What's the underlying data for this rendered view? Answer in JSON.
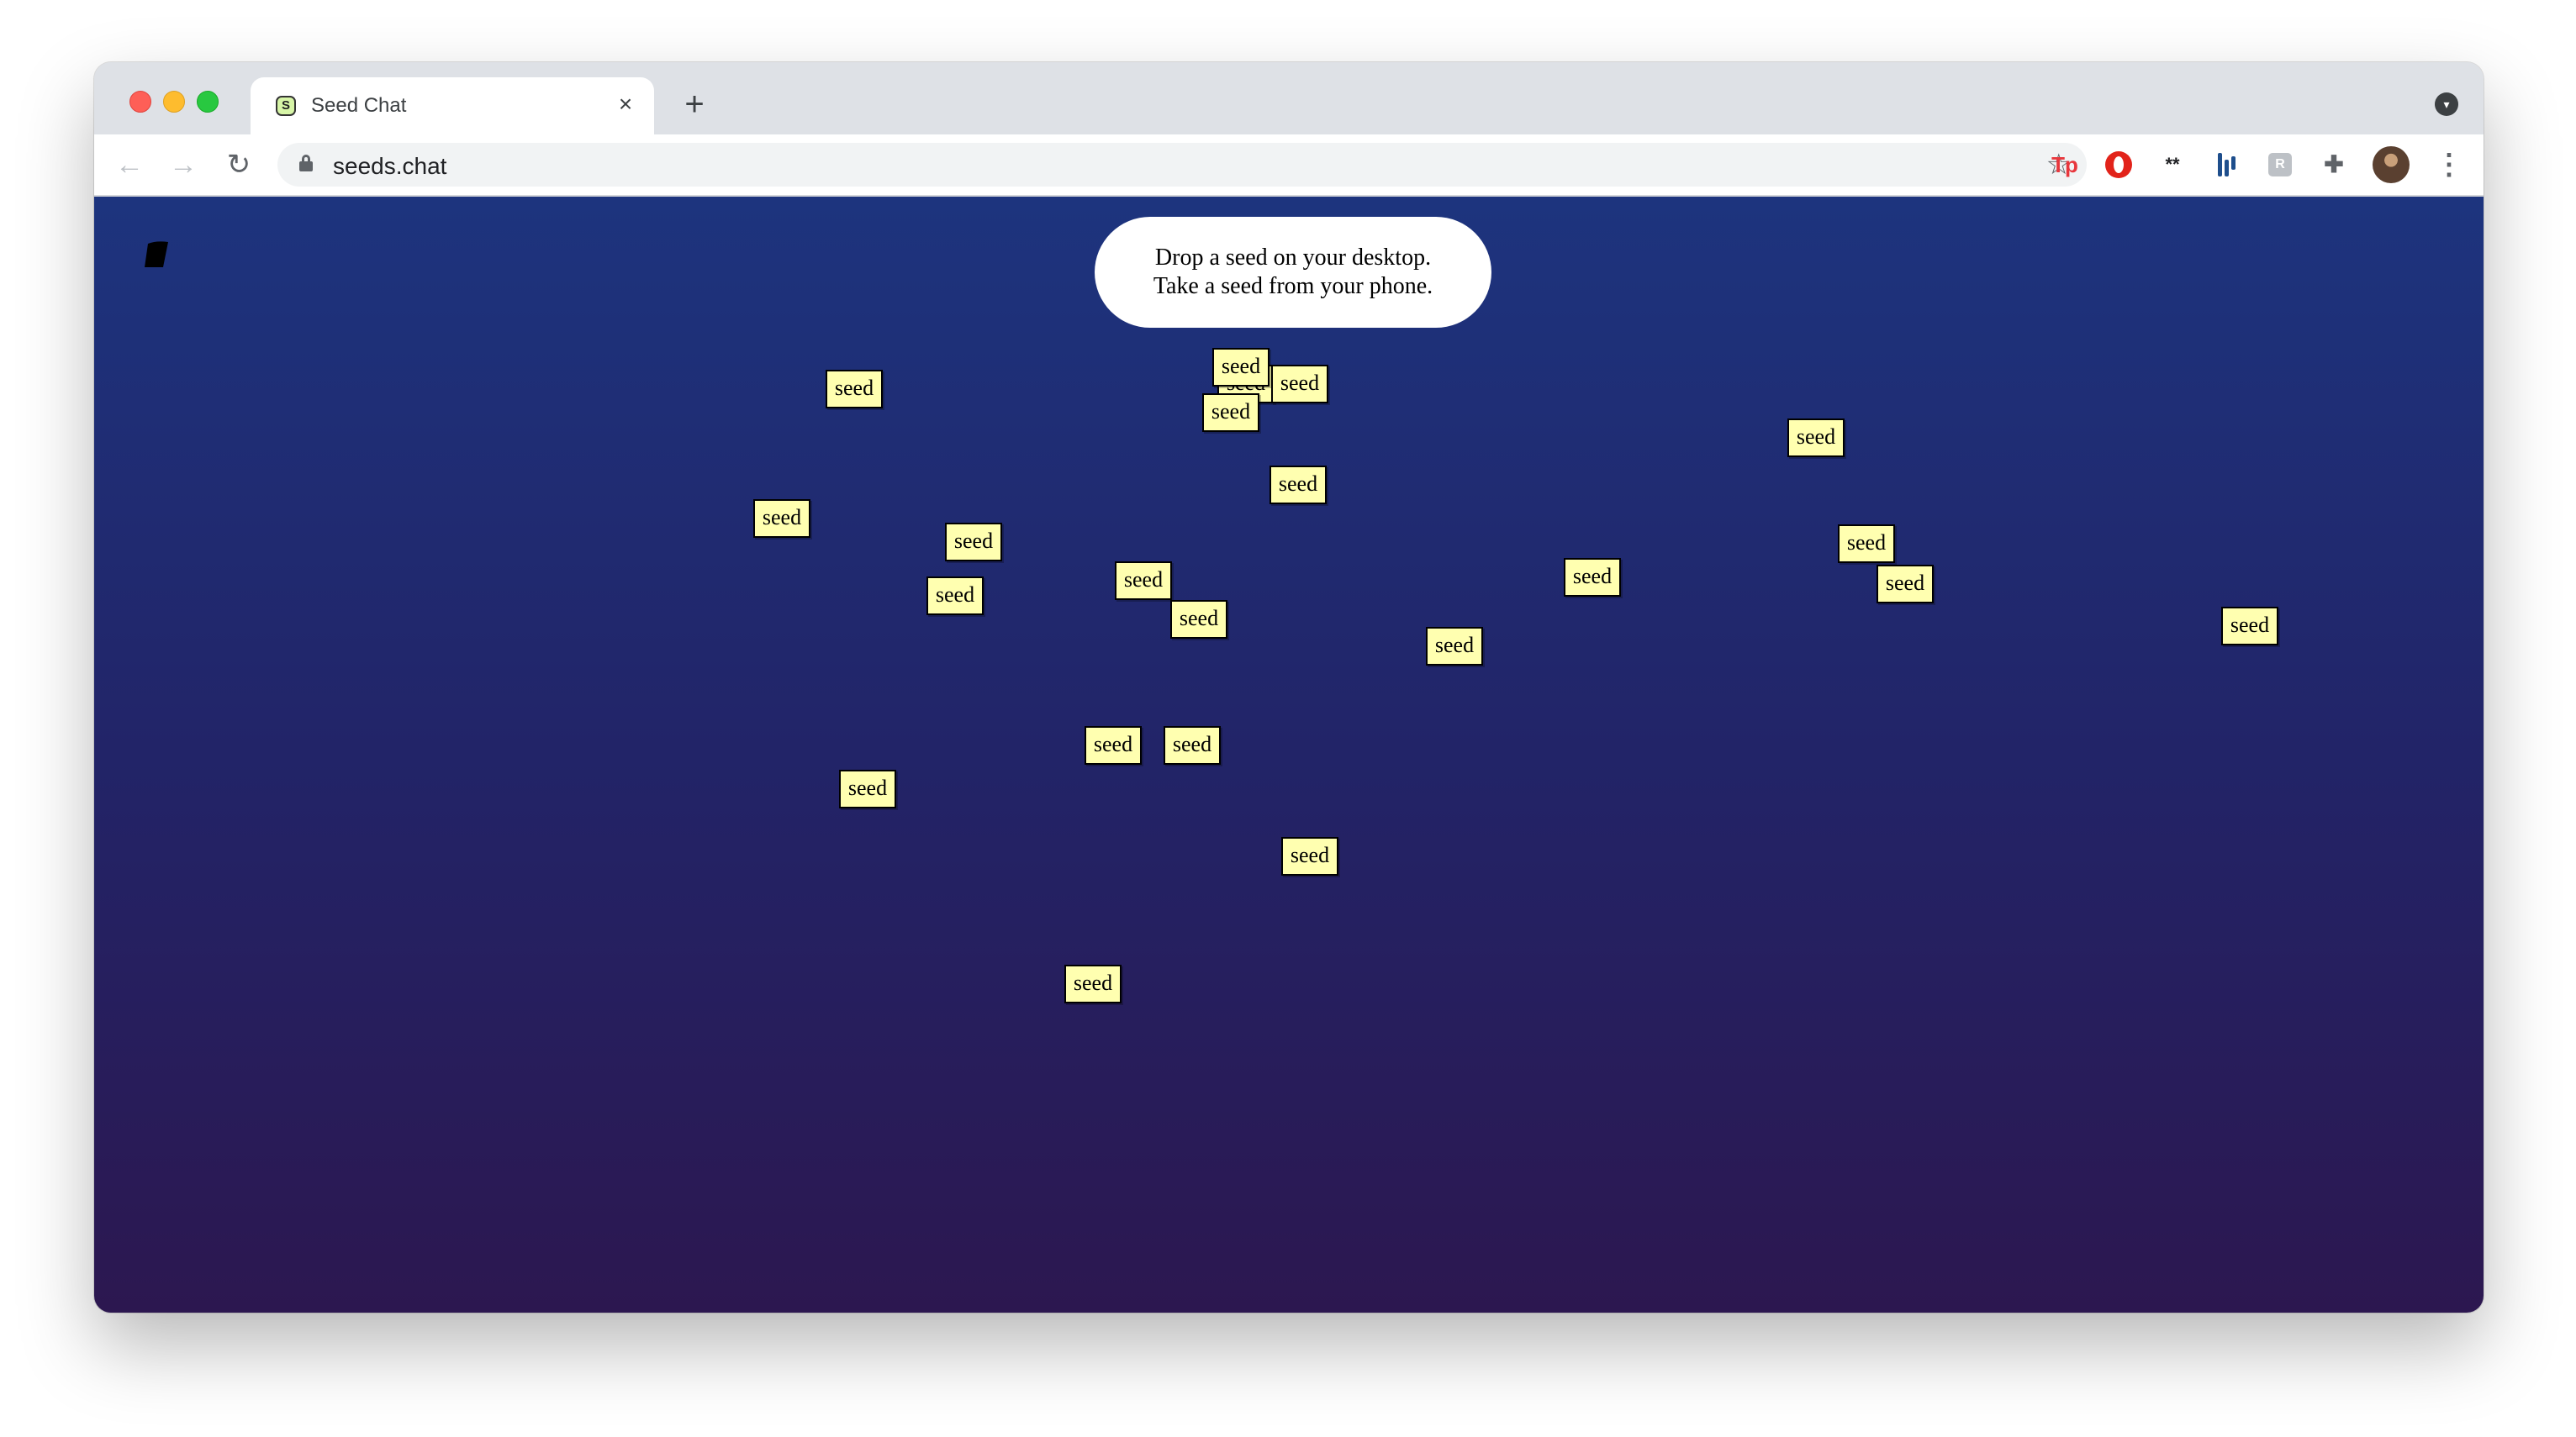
{
  "browser": {
    "tab_title": "Seed Chat",
    "tab_favicon": "S",
    "tab_close": "×",
    "new_tab": "+",
    "url": "seeds.chat",
    "icons": {
      "back": "arrow-left-icon",
      "forward": "arrow-right-icon",
      "reload": "reload-icon",
      "lock": "lock-icon",
      "bookmark": "star-icon",
      "extensions": "puzzle-icon",
      "menu": "kebab-menu-icon"
    },
    "extension_labels": {
      "tp": "Tp",
      "stars": "**",
      "grey": "R"
    }
  },
  "page": {
    "bubble_line1": "Drop a seed on your desktop.",
    "bubble_line2": "Take a seed from your phone.",
    "seed_label": "seed",
    "colors": {
      "seed_fill": "#ffffb0",
      "bg_top": "#1d347e",
      "bg_bottom": "#2c1750"
    }
  }
}
